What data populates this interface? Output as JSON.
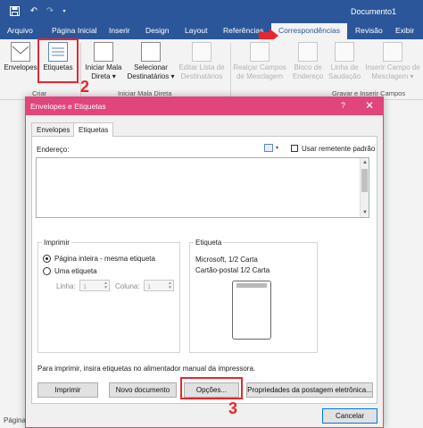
{
  "app": {
    "document_title": "Documento1",
    "accent_color": "#2b579a",
    "dialog_accent_color": "#e0457b",
    "annotation_color": "#e8262d"
  },
  "tabs": [
    "Arquivo",
    "Página Inicial",
    "Inserir",
    "Design",
    "Layout",
    "Referências",
    "Correspondências",
    "Revisão",
    "Exibir"
  ],
  "active_tab": "Correspondências",
  "ribbon": {
    "groups": [
      {
        "label": "Criar",
        "buttons": [
          {
            "label": "Envelopes",
            "icon": "envelope-icon"
          },
          {
            "label": "Etiquetas",
            "icon": "labels-icon"
          }
        ]
      },
      {
        "label": "Iniciar Mala Direta",
        "buttons": [
          {
            "label": "Iniciar Mala Direta ▾",
            "icon": "mail-merge-icon"
          },
          {
            "label": "Selecionar Destinatários ▾",
            "icon": "recipients-icon"
          },
          {
            "label": "Editar Lista de Destinatários",
            "icon": "edit-list-icon",
            "disabled": true
          }
        ]
      },
      {
        "label": "Gravar e Inserir Campos",
        "buttons": [
          {
            "label": "Realçar Campos de Mesclagem",
            "icon": "highlight-fields-icon",
            "disabled": true
          },
          {
            "label": "Bloco de Endereço",
            "icon": "address-block-icon",
            "disabled": true
          },
          {
            "label": "Linha de Saudação",
            "icon": "greeting-line-icon",
            "disabled": true
          },
          {
            "label": "Inserir Campo de Mesclagem ▾",
            "icon": "insert-field-icon",
            "disabled": true
          }
        ]
      }
    ]
  },
  "annotations": {
    "step2": "2",
    "step3": "3"
  },
  "dialog": {
    "title": "Envelopes e Etiquetas",
    "help": "?",
    "close": "✕",
    "tabs": [
      "Envelopes",
      "Etiquetas"
    ],
    "active_tab": "Etiquetas",
    "address_label": "Endereço:",
    "address_value": "",
    "use_return_address_label": "Usar remetente padrão",
    "use_return_address_checked": false,
    "print": {
      "title": "Imprimir",
      "full_page_label": "Página inteira - mesma etiqueta",
      "single_label": "Uma etiqueta",
      "selected": "full_page",
      "row_label": "Linha:",
      "row_value": "1",
      "column_label": "Coluna:",
      "column_value": "1"
    },
    "label": {
      "title": "Etiqueta",
      "line1": "Microsoft, 1/2 Carta",
      "line2": "Cartão-postal 1/2 Carta"
    },
    "instruction": "Para imprimir, insira etiquetas no alimentador manual da impressora.",
    "buttons": {
      "print": "Imprimir",
      "new_document": "Novo documento",
      "options": "Opções...",
      "postage_properties": "Propriedades da postagem eletrônica...",
      "cancel": "Cancelar"
    }
  },
  "status_bar": {
    "page_label": "Página"
  }
}
